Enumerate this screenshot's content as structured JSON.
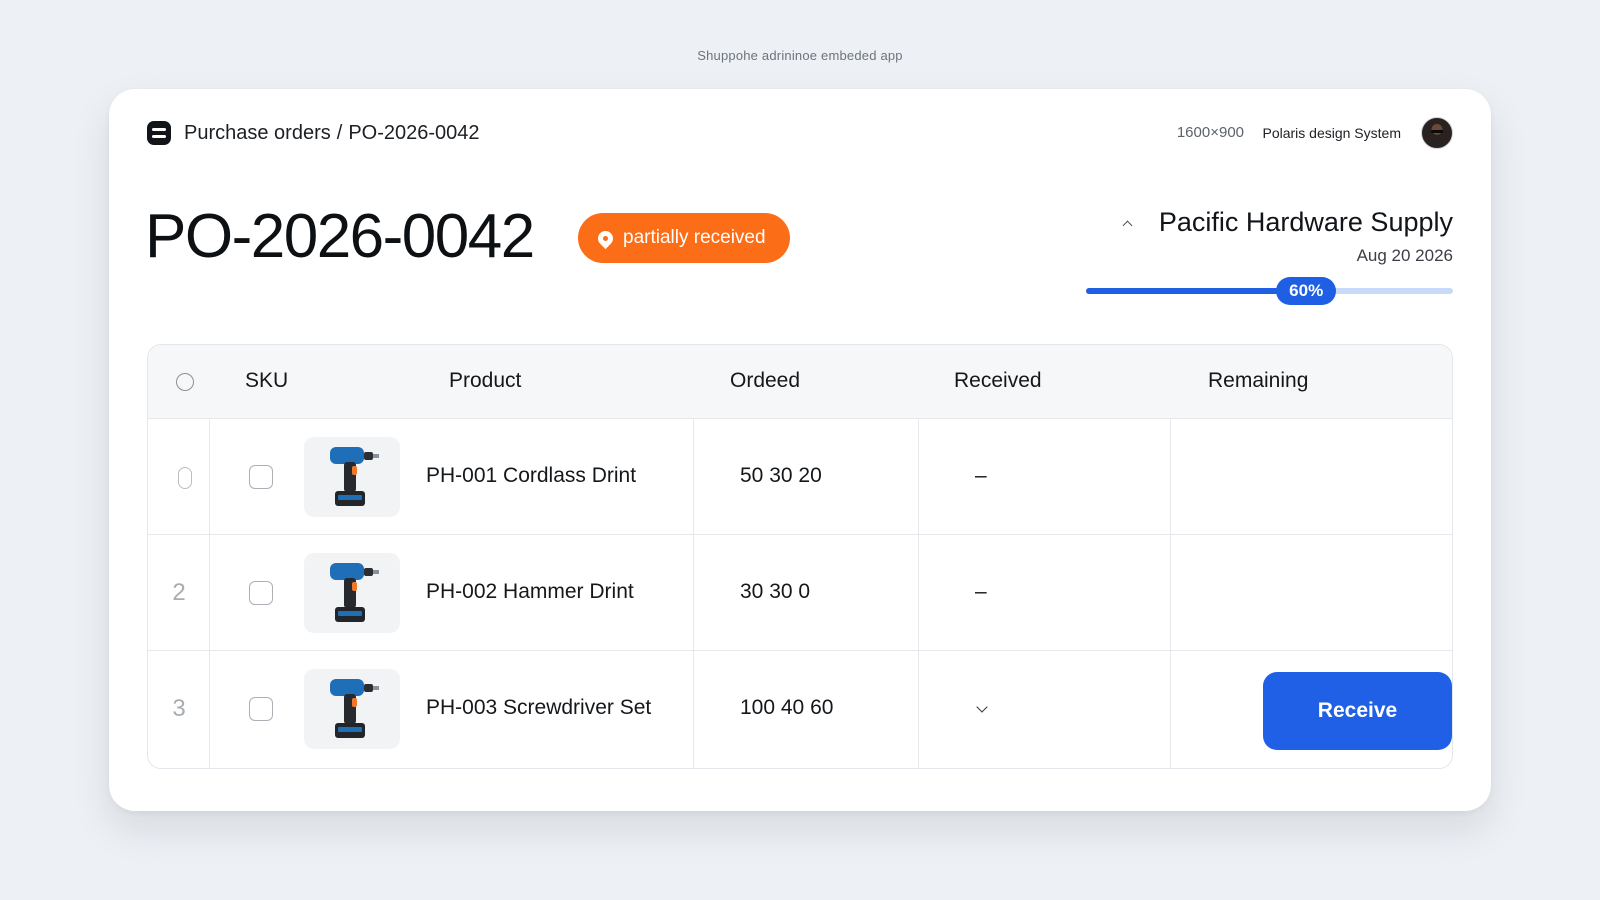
{
  "caption": "Shuppohe adrininoe embeded app",
  "topbar": {
    "breadcrumb_root": "Purchase orders",
    "breadcrumb_separator": "/",
    "breadcrumb_current": "PO-2026-0042",
    "dimensions": "1600×900",
    "system": "Polaris design System"
  },
  "header": {
    "title": "PO-2026-0042",
    "status": "partially received",
    "supplier": "Pacific Hardware Supply",
    "date": "Aug 20 2026",
    "progress_label": "60%",
    "progress_fraction": 0.6
  },
  "table": {
    "columns": [
      "SKU",
      "Product",
      "Ordeed",
      "Received",
      "Remaining"
    ],
    "rows": [
      {
        "index": "",
        "product": "PH-001 Cordlass Drint",
        "ordered": "50 30 20",
        "received": "–"
      },
      {
        "index": "2",
        "product": "PH-002 Hammer Drint",
        "ordered": "30 30 0",
        "received": "–"
      },
      {
        "index": "3",
        "product": "PH-003 Screwdriver Set",
        "ordered": "100 40 60",
        "received": ""
      }
    ],
    "receive_label": "Receive"
  },
  "colors": {
    "status_badge": "#fb6d17",
    "accent": "#1e5fe4",
    "progress_track": "#c8daf7"
  },
  "icons": [
    "app-icon",
    "pin-icon",
    "chevron-up-icon",
    "chevron-down-icon",
    "drill-icon",
    "avatar"
  ]
}
